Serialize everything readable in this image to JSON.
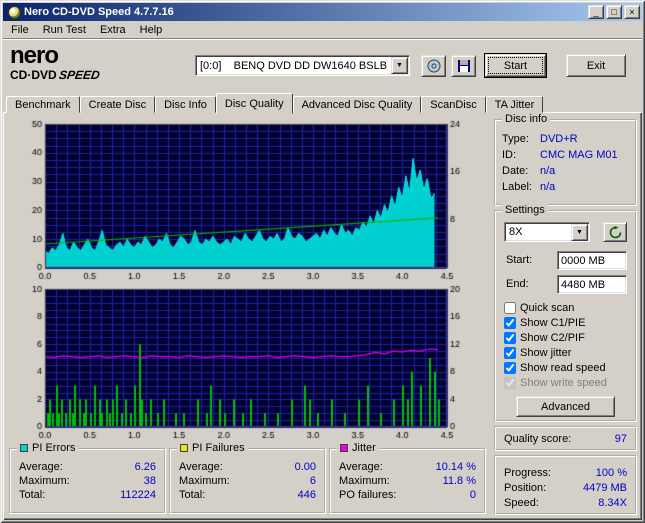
{
  "window": {
    "title": "Nero CD-DVD Speed 4.7.7.16",
    "buttons": {
      "minimize": "_",
      "maximize": "□",
      "close": "×"
    }
  },
  "icons": {
    "dropdown_arrow": "▼"
  },
  "menu": {
    "items": [
      "File",
      "Run Test",
      "Extra",
      "Help"
    ]
  },
  "toolbar": {
    "logo": {
      "line1": "nero",
      "line2": "CD·DVD",
      "line3": "SPEED"
    },
    "drive_select": "[0:0]    BENQ DVD DD DW1640 BSLB",
    "start_label": "Start",
    "exit_label": "Exit"
  },
  "tabs": [
    "Benchmark",
    "Create Disc",
    "Disc Info",
    "Disc Quality",
    "Advanced Disc Quality",
    "ScanDisc",
    "TA Jitter"
  ],
  "disc_info": {
    "title": "Disc info",
    "rows": [
      {
        "label": "Type:",
        "value": "DVD+R"
      },
      {
        "label": "ID:",
        "value": "CMC MAG M01"
      },
      {
        "label": "Date:",
        "value": "n/a"
      },
      {
        "label": "Label:",
        "value": "n/a"
      }
    ]
  },
  "settings": {
    "title": "Settings",
    "speed": "8X",
    "start_label": "Start:",
    "start_value": "0000 MB",
    "end_label": "End:",
    "end_value": "4480 MB",
    "checkboxes": [
      {
        "label": "Quick scan",
        "checked": false
      },
      {
        "label": "Show C1/PIE",
        "checked": true
      },
      {
        "label": "Show C2/PIF",
        "checked": true
      },
      {
        "label": "Show jitter",
        "checked": true
      },
      {
        "label": "Show read speed",
        "checked": true
      },
      {
        "label": "Show write speed",
        "checked": true,
        "disabled": true
      }
    ],
    "advanced_label": "Advanced"
  },
  "quality": {
    "label": "Quality score:",
    "value": "97"
  },
  "progress": {
    "rows": [
      {
        "label": "Progress:",
        "value": "100 %"
      },
      {
        "label": "Position:",
        "value": "4479 MB"
      },
      {
        "label": "Speed:",
        "value": "8.34X"
      }
    ]
  },
  "stats": {
    "pi_errors": {
      "title": "PI Errors",
      "color": "#00d2d2",
      "rows": [
        {
          "label": "Average:",
          "value": "6.26"
        },
        {
          "label": "Maximum:",
          "value": "38"
        },
        {
          "label": "Total:",
          "value": "112224"
        }
      ]
    },
    "pi_failures": {
      "title": "PI Failures",
      "color": "#e8e800",
      "rows": [
        {
          "label": "Average:",
          "value": "0.00"
        },
        {
          "label": "Maximum:",
          "value": "6"
        },
        {
          "label": "Total:",
          "value": "446"
        }
      ]
    },
    "jitter": {
      "title": "Jitter",
      "color": "#e800e8",
      "rows": [
        {
          "label": "Average:",
          "value": "10.14 %"
        },
        {
          "label": "Maximum:",
          "value": "11.8 %"
        },
        {
          "label": "PO failures:",
          "value": "0"
        }
      ]
    }
  },
  "chart_data": [
    {
      "type": "area",
      "title": "PI Errors vs position (GB)",
      "x_range": [
        0,
        4.5
      ],
      "x_ticks": [
        0,
        0.5,
        1,
        1.5,
        2,
        2.5,
        3,
        3.5,
        4,
        4.5
      ],
      "left_axis": {
        "min": 0,
        "max": 50,
        "ticks": [
          0,
          10,
          20,
          30,
          40,
          50
        ]
      },
      "right_axis": {
        "min": 0,
        "max": 24,
        "ticks": [
          8,
          16,
          24
        ]
      },
      "grid": {
        "x_step": 0.125,
        "y_step": 2.5
      },
      "bg": "#000030",
      "grid_color": "#2020a8",
      "series": [
        {
          "name": "PI Errors",
          "type": "area",
          "axis": "left",
          "color": "#00f0f0",
          "fill": "#00d0d0",
          "x_start": 0,
          "x_step": 0.04,
          "values": [
            6,
            5,
            7,
            6,
            8,
            12,
            7,
            6,
            9,
            7,
            6,
            8,
            10,
            7,
            6,
            9,
            13,
            8,
            7,
            6,
            8,
            9,
            7,
            10,
            8,
            7,
            9,
            8,
            11,
            9,
            7,
            8,
            10,
            9,
            12,
            8,
            7,
            9,
            11,
            10,
            8,
            9,
            13,
            9,
            8,
            10,
            9,
            11,
            9,
            8,
            9,
            10,
            8,
            11,
            10,
            9,
            12,
            10,
            9,
            11,
            13,
            10,
            9,
            11,
            10,
            12,
            9,
            10,
            14,
            11,
            10,
            12,
            11,
            9,
            10,
            11,
            12,
            10,
            13,
            11,
            14,
            12,
            11,
            15,
            12,
            13,
            11,
            14,
            13,
            16,
            14,
            18,
            15,
            20,
            17,
            22,
            19,
            25,
            21,
            28,
            24,
            32,
            26,
            38,
            30,
            34,
            27,
            31,
            24,
            26
          ]
        },
        {
          "name": "Read speed (X)",
          "type": "line",
          "axis": "right",
          "color": "#00b400",
          "x": [
            0,
            4.4
          ],
          "values": [
            4.0,
            8.34
          ]
        }
      ]
    },
    {
      "type": "line",
      "title": "Jitter and PI Failures vs position (GB)",
      "x_range": [
        0,
        4.5
      ],
      "x_ticks": [
        0,
        0.5,
        1,
        1.5,
        2,
        2.5,
        3,
        3.5,
        4,
        4.5
      ],
      "left_axis": {
        "min": 0,
        "max": 10,
        "ticks": [
          0,
          2,
          4,
          6,
          8,
          10
        ]
      },
      "right_axis": {
        "min": 0,
        "max": 20,
        "ticks": [
          0,
          4,
          8,
          12,
          16,
          20
        ]
      },
      "grid": {
        "x_step": 0.125,
        "y_step": 0.5
      },
      "bg": "#000030",
      "grid_color": "#2020a8",
      "series": [
        {
          "name": "PI Failures",
          "type": "bars",
          "axis": "left",
          "color": "#00c000",
          "points": [
            [
              0.02,
              1
            ],
            [
              0.05,
              2
            ],
            [
              0.08,
              1
            ],
            [
              0.12,
              3
            ],
            [
              0.15,
              1
            ],
            [
              0.18,
              2
            ],
            [
              0.22,
              1
            ],
            [
              0.27,
              2
            ],
            [
              0.3,
              1
            ],
            [
              0.33,
              3
            ],
            [
              0.38,
              2
            ],
            [
              0.42,
              1
            ],
            [
              0.45,
              2
            ],
            [
              0.5,
              1
            ],
            [
              0.55,
              3
            ],
            [
              0.6,
              2
            ],
            [
              0.63,
              1
            ],
            [
              0.68,
              2
            ],
            [
              0.72,
              1
            ],
            [
              0.75,
              2
            ],
            [
              0.8,
              3
            ],
            [
              0.85,
              1
            ],
            [
              0.9,
              2
            ],
            [
              0.95,
              1
            ],
            [
              1.0,
              3
            ],
            [
              1.05,
              6
            ],
            [
              1.08,
              2
            ],
            [
              1.12,
              1
            ],
            [
              1.18,
              2
            ],
            [
              1.25,
              1
            ],
            [
              1.32,
              2
            ],
            [
              1.45,
              1
            ],
            [
              1.55,
              1
            ],
            [
              1.7,
              2
            ],
            [
              1.8,
              1
            ],
            [
              1.85,
              3
            ],
            [
              1.95,
              2
            ],
            [
              2.0,
              1
            ],
            [
              2.1,
              2
            ],
            [
              2.2,
              1
            ],
            [
              2.3,
              2
            ],
            [
              2.45,
              1
            ],
            [
              2.6,
              1
            ],
            [
              2.75,
              2
            ],
            [
              2.9,
              3
            ],
            [
              2.95,
              2
            ],
            [
              3.05,
              1
            ],
            [
              3.2,
              2
            ],
            [
              3.35,
              1
            ],
            [
              3.5,
              2
            ],
            [
              3.6,
              3
            ],
            [
              3.75,
              1
            ],
            [
              3.9,
              2
            ],
            [
              4.0,
              3
            ],
            [
              4.05,
              2
            ],
            [
              4.1,
              4
            ],
            [
              4.2,
              3
            ],
            [
              4.3,
              5
            ],
            [
              4.35,
              4
            ],
            [
              4.4,
              2
            ]
          ]
        },
        {
          "name": "Jitter (%)",
          "type": "line",
          "axis": "right",
          "color": "#e600e6",
          "x_start": 0,
          "x_step": 0.1,
          "values": [
            10.2,
            10.1,
            10.3,
            10.2,
            10.1,
            10.2,
            10.3,
            10.1,
            10.2,
            10.3,
            10.2,
            10.1,
            10.3,
            10.2,
            10.2,
            10.1,
            10.3,
            10.2,
            10.1,
            10.2,
            10.3,
            10.2,
            10.1,
            10.2,
            10.2,
            10.3,
            10.1,
            10.2,
            10.3,
            10.2,
            10.1,
            10.2,
            10.3,
            10.2,
            10.2,
            10.3,
            10.5,
            10.8,
            10.6,
            11.0,
            10.9,
            11.1,
            11.0,
            11.3,
            11.2
          ]
        }
      ]
    }
  ]
}
